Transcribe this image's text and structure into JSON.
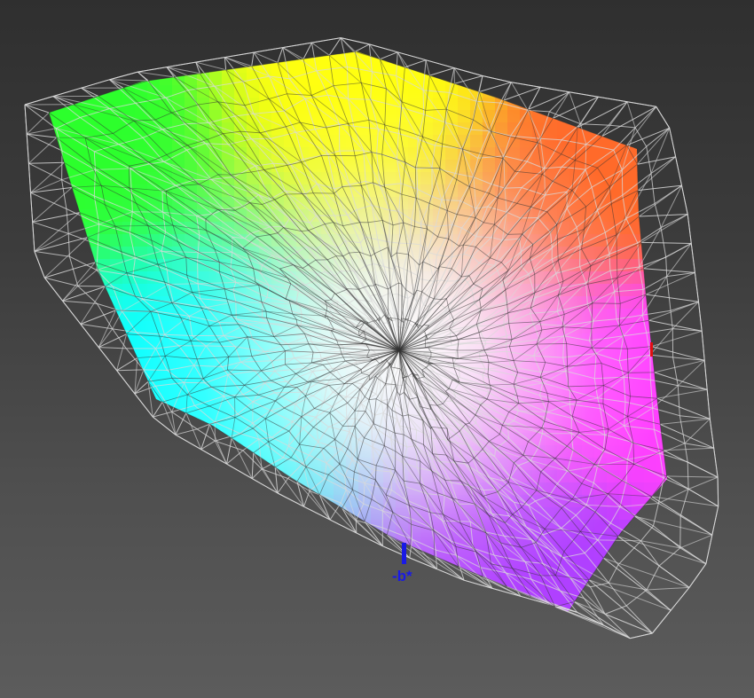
{
  "gamut_view": {
    "axes": {
      "b_minus": {
        "label": "-b*",
        "color": "#1a1ae6"
      },
      "a_plus": {
        "label": "",
        "color": "#e01010"
      }
    },
    "colors": {
      "background_top": "#2f2f2f",
      "background_bottom": "#5c5c5c",
      "wireframe_outer": "#d9d9d9",
      "wireframe_inner": "#333333",
      "gamut_corners": {
        "green": "#2cff2c",
        "yellow": "#ffff10",
        "orange": "#ff6a2a",
        "magenta": "#ff40ff",
        "violet": "#b040ff",
        "cyan": "#10ffff",
        "white": "#ffffff"
      }
    }
  }
}
